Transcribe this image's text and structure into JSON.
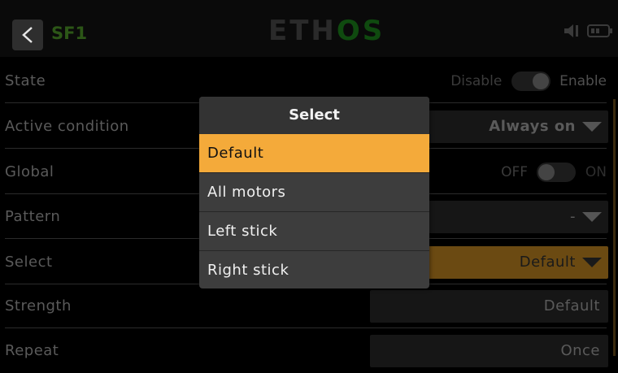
{
  "header": {
    "back_icon": "chevron-left-icon",
    "title": "SF1",
    "logo": {
      "prefix": "ETH",
      "highlight": "OS"
    },
    "icons": [
      "speaker-icon",
      "battery-icon"
    ]
  },
  "rows": [
    {
      "label": "State",
      "toggle": {
        "off_label": "Disable",
        "on_label": "Enable",
        "value": "Enable"
      }
    },
    {
      "label": "Active condition",
      "value": "Always on"
    },
    {
      "label": "Global",
      "toggle": {
        "off_label": "OFF",
        "on_label": "ON",
        "value": "OFF"
      }
    },
    {
      "label": "Pattern",
      "value": "-"
    },
    {
      "label": "Select",
      "value": "Default"
    },
    {
      "label": "Strength",
      "value": "Default"
    },
    {
      "label": "Repeat",
      "value": "Once"
    }
  ],
  "popup": {
    "title": "Select",
    "options": [
      "Default",
      "All motors",
      "Left stick",
      "Right stick"
    ],
    "selected": "Default"
  },
  "colors": {
    "accent": "#f4aa3a",
    "accent_dim": "#6b4a12",
    "brand_green": "#0f4a0f"
  }
}
